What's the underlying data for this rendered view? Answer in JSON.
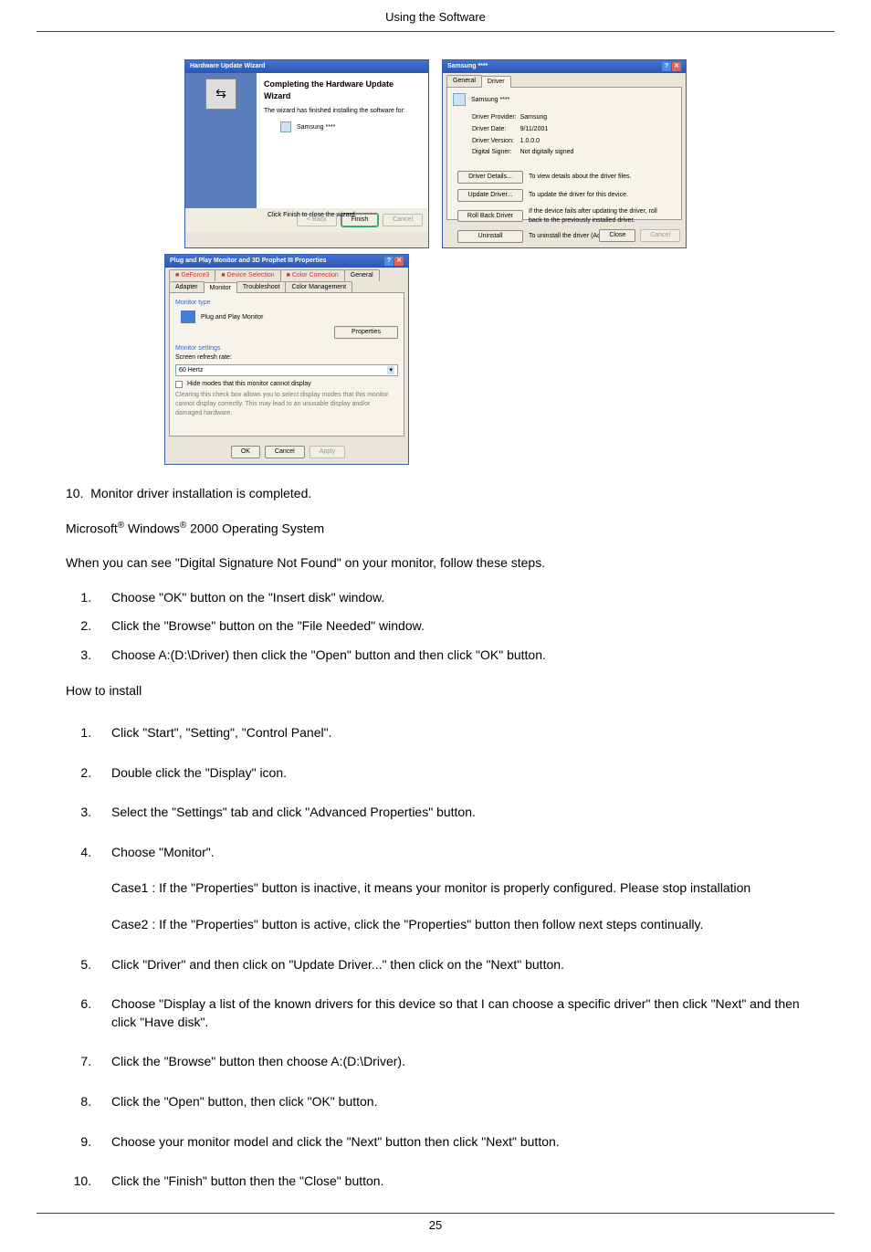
{
  "header": "Using the Software",
  "dlg1": {
    "title": "Hardware Update Wizard",
    "h": "Completing the Hardware Update Wizard",
    "line1": "The wizard has finished installing the software for:",
    "device": "Samsung ****",
    "line2": "Click Finish to close the wizard.",
    "back": "< Back",
    "finish": "Finish",
    "cancel": "Cancel"
  },
  "dlg2": {
    "title": "Samsung ****",
    "tab1": "General",
    "tab2": "Driver",
    "head": "Samsung ****",
    "l1a": "Driver Provider:",
    "l1b": "Samsung",
    "l2a": "Driver Date:",
    "l2b": "9/11/2001",
    "l3a": "Driver Version:",
    "l3b": "1.0.0.0",
    "l4a": "Digital Signer:",
    "l4b": "Not digitally signed",
    "b1": "Driver Details...",
    "b1t": "To view details about the driver files.",
    "b2": "Update Driver...",
    "b2t": "To update the driver for this device.",
    "b3": "Roll Back Driver",
    "b3t": "If the device fails after updating the driver, roll back to the previously installed driver.",
    "b4": "Uninstall",
    "b4t": "To uninstall the driver (Advanced).",
    "close": "Close",
    "cancel": "Cancel"
  },
  "dlg3": {
    "title": "Plug and Play Monitor and 3D Prophet III Properties",
    "tabA": "GeForce3",
    "tabB": "Device Selection",
    "tabC": "Color Correction",
    "tabD": "General",
    "tabE": "Adapter",
    "tabF": "Monitor",
    "tabG": "Troubleshoot",
    "tabH": "Color Management",
    "secA": "Monitor type",
    "ptype": "Plug and Play Monitor",
    "props": "Properties",
    "secB": "Monitor settings",
    "refresh": "Screen refresh rate:",
    "hz": "60 Hertz",
    "chk": "Hide modes that this monitor cannot display",
    "warn": "Clearing this check box allows you to select display modes that this monitor cannot display correctly. This may lead to an unusable display and/or damaged hardware.",
    "ok": "OK",
    "cancel": "Cancel",
    "apply": "Apply"
  },
  "s10": "Monitor driver installation is completed.",
  "os_a": "Microsoft",
  "os_b": " Windows",
  "os_c": " 2000 Operating System",
  "sigline": "When you can see \"Digital Signature Not Found\" on your monitor, follow these steps.",
  "l1": "Choose \"OK\" button on the \"Insert disk\" window.",
  "l2": "Click the \"Browse\" button on the \"File Needed\" window.",
  "l3": "Choose A:(D:\\Driver) then click the \"Open\" button and then click \"OK\" button.",
  "howto": "How to install",
  "h1": "Click \"Start\", \"Setting\", \"Control Panel\".",
  "h2": "Double click the \"Display\" icon.",
  "h3": "Select the \"Settings\" tab and click \"Advanced Properties\" button.",
  "h4": "Choose \"Monitor\".",
  "case1": "Case1 : If the \"Properties\" button is inactive, it means your monitor is properly configured. Please stop installation",
  "case2": "Case2 : If the \"Properties\" button is active, click the \"Properties\" button then follow next steps continually.",
  "h5": "Click \"Driver\" and then click on \"Update Driver...\" then click on the \"Next\" button.",
  "h6": "Choose \"Display a list of the known drivers for this device so that I can choose a specific driver\" then click \"Next\" and then click \"Have disk\".",
  "h7": "Click the \"Browse\" button then choose A:(D:\\Driver).",
  "h8": "Click the \"Open\" button, then click \"OK\" button.",
  "h9": "Choose your monitor model and click the \"Next\" button then click \"Next\" button.",
  "h10": "Click the \"Finish\" button then the \"Close\" button.",
  "pagenum": "25"
}
